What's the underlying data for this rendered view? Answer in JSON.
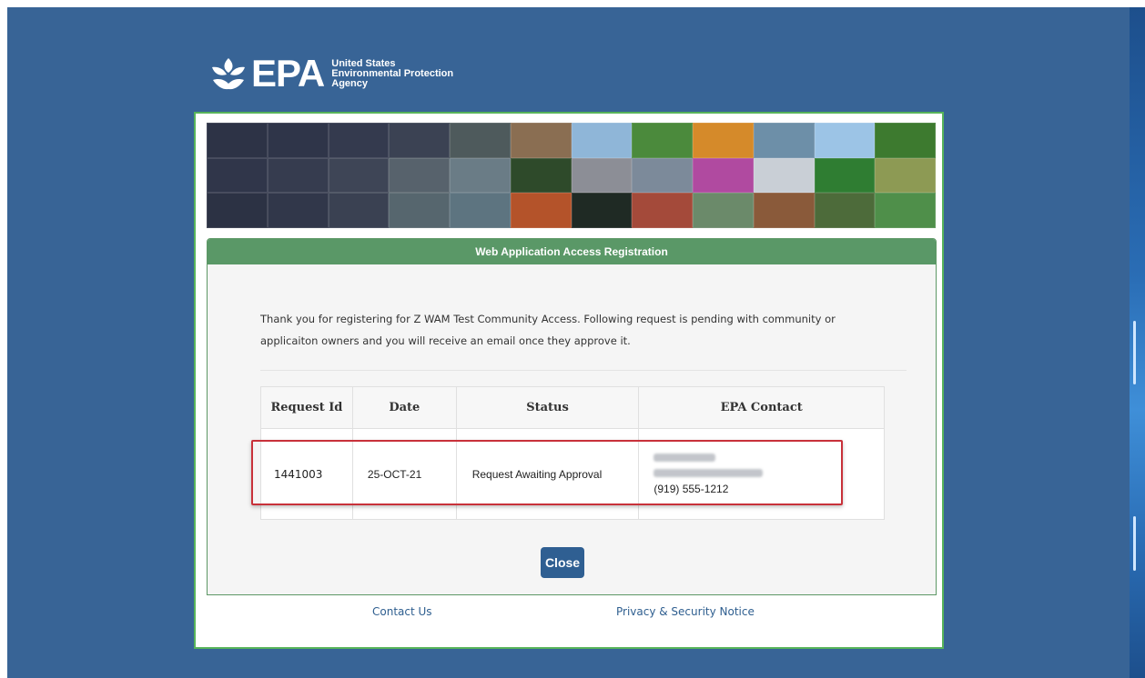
{
  "agency": {
    "abbr": "EPA",
    "line1": "United States",
    "line2": "Environmental Protection",
    "line3": "Agency"
  },
  "panel": {
    "title": "Web Application Access Registration",
    "message_line1": "Thank you for registering for Z WAM Test Community Access. Following request is pending with community or",
    "message_line2": "applicaiton owners and you will receive an email once they approve it."
  },
  "table": {
    "headers": [
      "Request Id",
      "Date",
      "Status",
      "EPA Contact"
    ],
    "row": {
      "request_id": "1441003",
      "date": "25-OCT-21",
      "status": "Request Awaiting Approval",
      "contact_phone": "(919) 555-1212"
    }
  },
  "buttons": {
    "close": "Close"
  },
  "footer": {
    "contact": "Contact Us",
    "privacy": "Privacy & Security Notice"
  },
  "colors": {
    "background": "#386496",
    "card_border": "#57b35a",
    "panel_header": "#5a9867",
    "button": "#2f5f92",
    "highlight": "#c8313a",
    "link": "#2e5e8f"
  }
}
